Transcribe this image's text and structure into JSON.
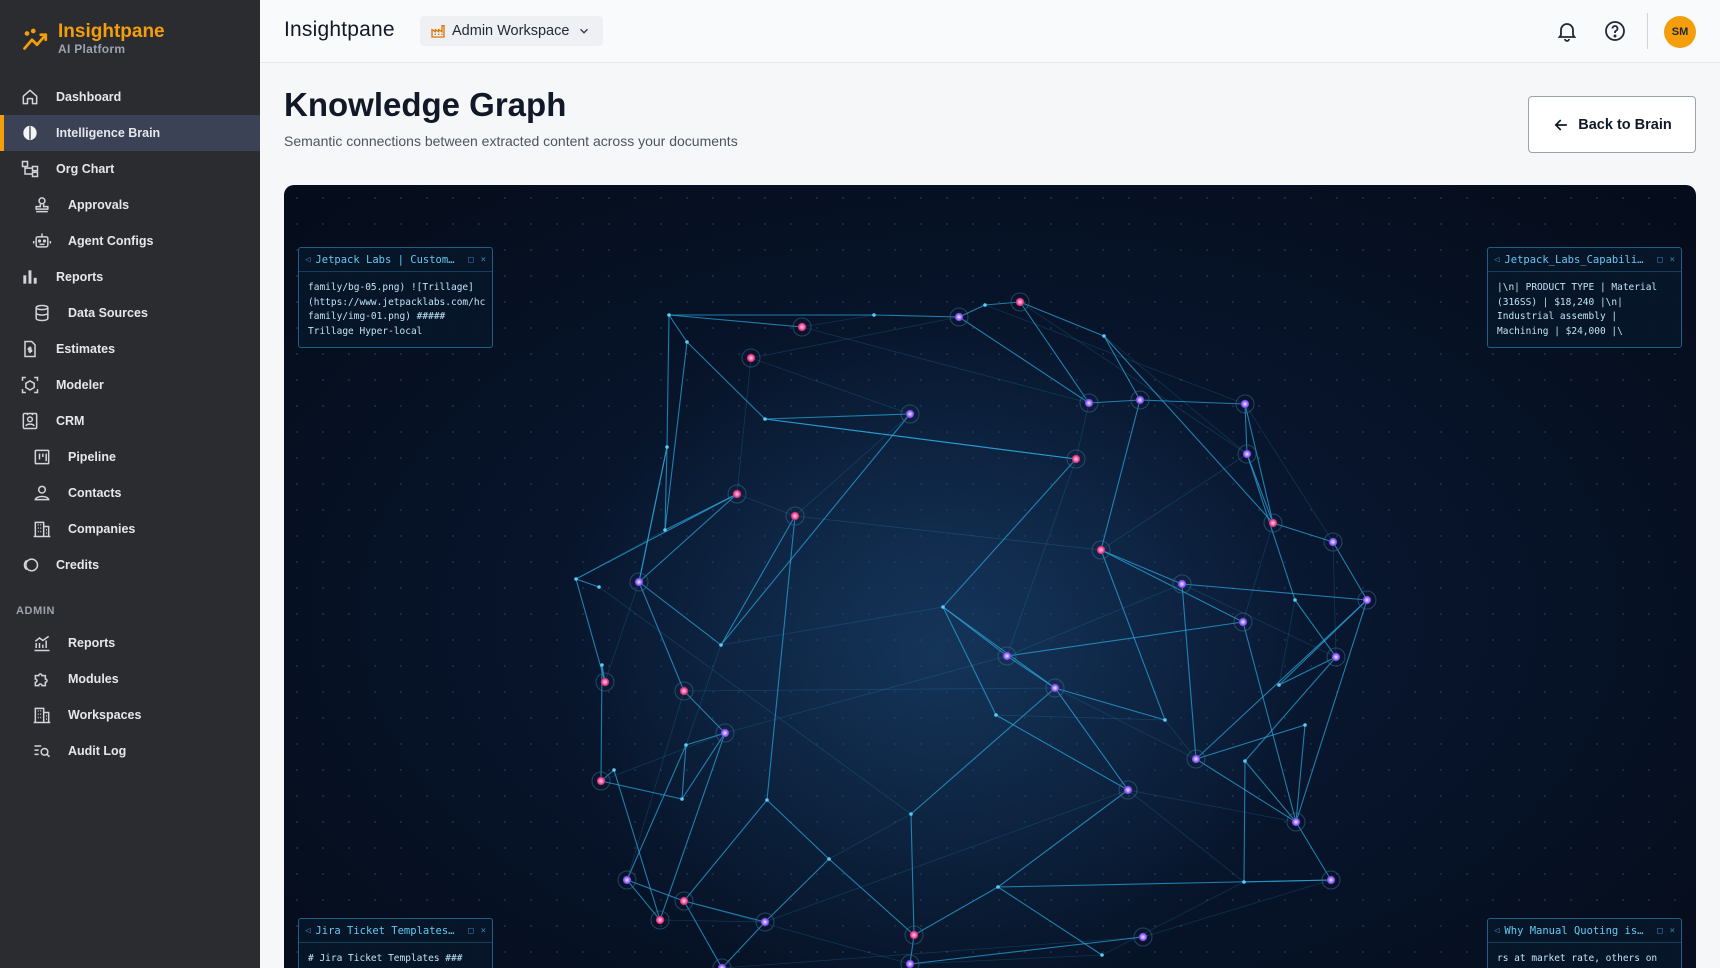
{
  "brand": {
    "name": "Insightpane",
    "subtitle": "AI Platform",
    "accent": "#f59e0b"
  },
  "sidebar": {
    "items": [
      {
        "label": "Dashboard",
        "icon": "home-icon",
        "sub": false,
        "active": false
      },
      {
        "label": "Intelligence Brain",
        "icon": "brain-icon",
        "sub": false,
        "active": true
      },
      {
        "label": "Org Chart",
        "icon": "org-chart-icon",
        "sub": false,
        "active": false
      },
      {
        "label": "Approvals",
        "icon": "stamp-icon",
        "sub": true,
        "active": false
      },
      {
        "label": "Agent Configs",
        "icon": "bot-icon",
        "sub": true,
        "active": false
      },
      {
        "label": "Reports",
        "icon": "bar-chart-icon",
        "sub": false,
        "active": false
      },
      {
        "label": "Data Sources",
        "icon": "database-icon",
        "sub": true,
        "active": false
      },
      {
        "label": "Estimates",
        "icon": "document-dollar-icon",
        "sub": false,
        "active": false
      },
      {
        "label": "Modeler",
        "icon": "cube-scan-icon",
        "sub": false,
        "active": false
      },
      {
        "label": "CRM",
        "icon": "contact-card-icon",
        "sub": false,
        "active": false
      },
      {
        "label": "Pipeline",
        "icon": "kanban-icon",
        "sub": true,
        "active": false
      },
      {
        "label": "Contacts",
        "icon": "user-icon",
        "sub": true,
        "active": false
      },
      {
        "label": "Companies",
        "icon": "building-icon",
        "sub": true,
        "active": false
      },
      {
        "label": "Credits",
        "icon": "coins-icon",
        "sub": false,
        "active": false
      }
    ],
    "admin_section": "ADMIN",
    "admin_items": [
      {
        "label": "Reports",
        "icon": "line-chart-icon"
      },
      {
        "label": "Modules",
        "icon": "puzzle-icon"
      },
      {
        "label": "Workspaces",
        "icon": "building-icon"
      },
      {
        "label": "Audit Log",
        "icon": "search-list-icon"
      }
    ]
  },
  "topbar": {
    "title": "Insightpane",
    "workspace": "Admin Workspace",
    "notifications_icon": "bell-icon",
    "help_icon": "help-circle-icon",
    "avatar_initials": "SM"
  },
  "page": {
    "title": "Knowledge Graph",
    "subtitle": "Semantic connections between extracted content across your documents",
    "back_label": "Back to Brain"
  },
  "cards": [
    {
      "title": "Jetpack Labs | Custom…",
      "body": "family/bg-05.png) ![Trillage]\n(https://www.jetpacklabs.com/hc\nfamily/img-01.png) #####\nTrillage Hyper-local"
    },
    {
      "title": "Jetpack_Labs_Capabili…",
      "body": "|\\n| PRODUCT TYPE | Material\n(316SS) | $18,240 |\\n|\nIndustrial assembly |\nMachining | $24,000 |\\"
    },
    {
      "title": "Jira Ticket Templates…",
      "body": "# Jira Ticket Templates ###"
    },
    {
      "title": "Why Manual Quoting is…",
      "body": "rs at market rate, others on"
    }
  ],
  "colors": {
    "node_pink": "#f472b6",
    "node_purple": "#a78bfa",
    "edge": "#2aa3d8",
    "graph_bg": "#050c1a"
  }
}
